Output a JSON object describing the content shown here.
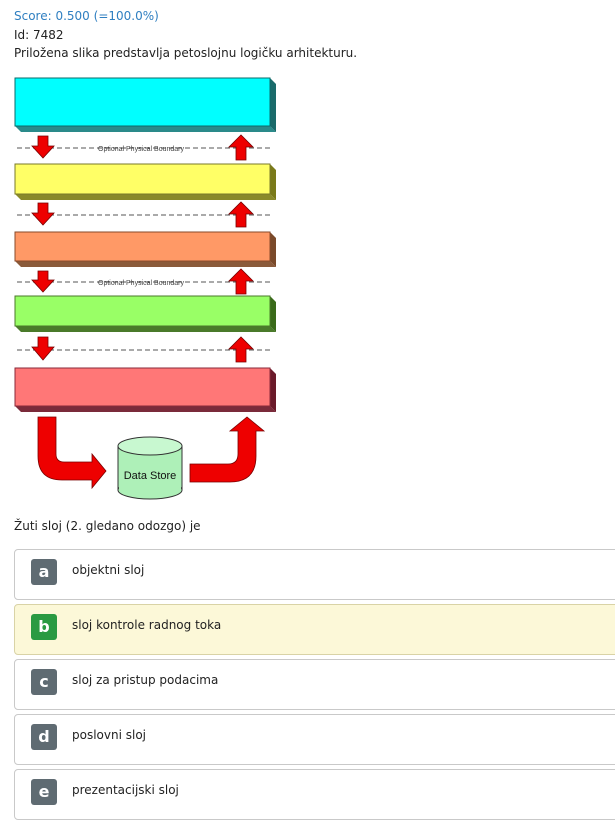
{
  "header": {
    "score": "Score: 0.500 (=100.0%)",
    "id": "Id: 7482",
    "intro": "Priložena slika predstavlja petoslojnu logičku arhitekturu."
  },
  "diagram": {
    "layer_colors": [
      "#00ffff",
      "#ffff66",
      "#ff9966",
      "#99ff66",
      "#ff7777"
    ],
    "boundary_label": "Optional Physical Boundary",
    "data_store_label": "Data Store",
    "arrow_color": "#ee0000",
    "store_color": "#aef0b8"
  },
  "question": "Žuti sloj (2. gledano odozgo) je",
  "options": [
    {
      "letter": "a",
      "text": "objektni sloj",
      "correct": false
    },
    {
      "letter": "b",
      "text": "sloj kontrole radnog toka",
      "correct": true
    },
    {
      "letter": "c",
      "text": "sloj za pristup podacima",
      "correct": false
    },
    {
      "letter": "d",
      "text": "poslovni sloj",
      "correct": false
    },
    {
      "letter": "e",
      "text": "prezentacijski sloj",
      "correct": false
    }
  ]
}
